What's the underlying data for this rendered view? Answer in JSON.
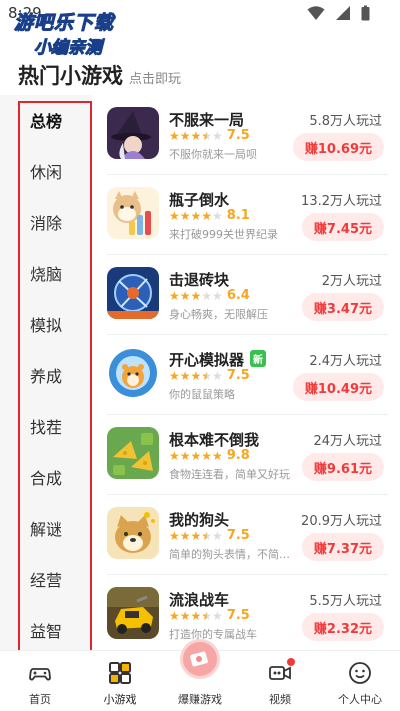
{
  "status_bar": {
    "time": "8:29"
  },
  "watermark": {
    "line1": "游吧乐下载",
    "line2": "小编亲测"
  },
  "header": {
    "title": "热门小游戏",
    "subtitle": "点击即玩"
  },
  "sidebar": {
    "items": [
      {
        "label": "总榜",
        "active": true
      },
      {
        "label": "休闲"
      },
      {
        "label": "消除"
      },
      {
        "label": "烧脑"
      },
      {
        "label": "模拟"
      },
      {
        "label": "养成"
      },
      {
        "label": "找茬"
      },
      {
        "label": "合成"
      },
      {
        "label": "解谜"
      },
      {
        "label": "经营"
      },
      {
        "label": "益智"
      }
    ]
  },
  "games": [
    {
      "name": "不服来一局",
      "score": "7.5",
      "stars": 3.5,
      "desc": "不服你就来一局呗",
      "players": "5.8万人玩过",
      "earn": "赚10.69元",
      "icon_name": "witch-game-icon",
      "icon_colors": [
        "#3b2a4d",
        "#9b7fd0"
      ]
    },
    {
      "name": "瓶子倒水",
      "score": "8.1",
      "stars": 4,
      "desc": "来打破999关世界纪录",
      "players": "13.2万人玩过",
      "earn": "赚7.45元",
      "icon_name": "shiba-bottles-icon",
      "icon_colors": [
        "#e9c08a",
        "#7fb6e8"
      ]
    },
    {
      "name": "击退砖块",
      "score": "6.4",
      "stars": 3,
      "desc": "身心畅爽，无限解压",
      "players": "2万人玩过",
      "earn": "赚3.47元",
      "icon_name": "brick-breaker-icon",
      "icon_colors": [
        "#1a3a7a",
        "#e56b2c"
      ]
    },
    {
      "name": "开心模拟器",
      "badge": "新",
      "score": "7.5",
      "stars": 3.5,
      "desc": "你的鼠鼠策略",
      "players": "2.4万人玩过",
      "earn": "赚10.49元",
      "icon_name": "hamster-gear-icon",
      "icon_colors": [
        "#3a8fd8",
        "#f3a53a"
      ]
    },
    {
      "name": "根本难不倒我",
      "score": "9.8",
      "stars": 5,
      "desc": "食物连连看，简单又好玩",
      "players": "24万人玩过",
      "earn": "赚9.61元",
      "icon_name": "cheese-match-icon",
      "icon_colors": [
        "#6aa84f",
        "#f1c232"
      ]
    },
    {
      "name": "我的狗头",
      "score": "7.5",
      "stars": 3.5,
      "desc": "简单的狗头表情，不简单的玩法",
      "players": "20.9万人玩过",
      "earn": "赚7.37元",
      "icon_name": "doge-head-icon",
      "icon_colors": [
        "#f6e3b8",
        "#d9a44d"
      ]
    },
    {
      "name": "流浪战车",
      "score": "7.5",
      "stars": 3.5,
      "desc": "打造你的专属战车",
      "players": "5.5万人玩过",
      "earn": "赚2.32元",
      "icon_name": "battle-car-icon",
      "icon_colors": [
        "#5a4a2a",
        "#f5c000"
      ]
    }
  ],
  "bottom_nav": [
    {
      "label": "首页",
      "icon": "gamepad-icon"
    },
    {
      "label": "小游戏",
      "icon": "grid-icon",
      "active": true
    },
    {
      "label": "爆赚游戏",
      "icon": "money-icon"
    },
    {
      "label": "视频",
      "icon": "video-icon"
    },
    {
      "label": "个人中心",
      "icon": "smiley-icon"
    }
  ]
}
